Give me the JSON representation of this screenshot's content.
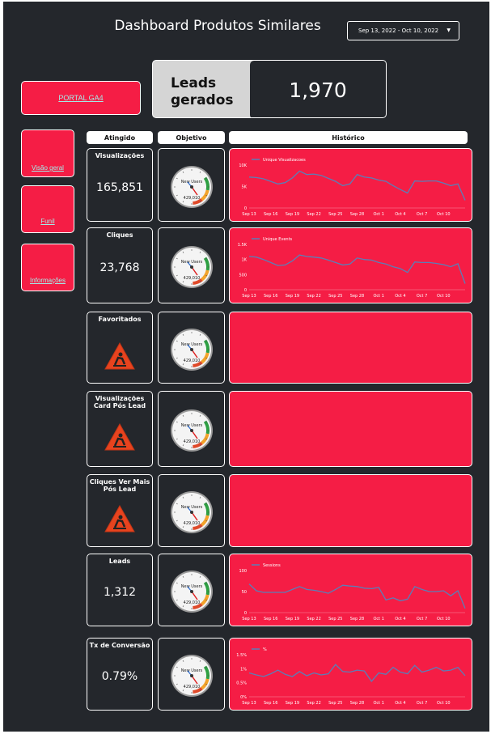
{
  "header": {
    "title": "Dashboard Produtos Similares",
    "date_range": "Sep 13, 2022 - Oct 10, 2022"
  },
  "portal": {
    "label": "PORTAL GA4"
  },
  "kpi": {
    "label_line1": "Leads",
    "label_line2": "gerados",
    "value": "1,970"
  },
  "nav": [
    {
      "label": "Visão geral"
    },
    {
      "label": "Funil"
    },
    {
      "label": "Informações"
    }
  ],
  "columns": {
    "atingido": "Atingido",
    "objetivo": "Objetivo",
    "historico": "Histórico"
  },
  "gauge": {
    "label": "New Users",
    "value": "429,010"
  },
  "colors": {
    "accent": "#f51d45",
    "background": "#24272c",
    "line": "#5a7fb8",
    "link": "#a4ece9"
  },
  "x_ticks": [
    "Sep 13",
    "Sep 16",
    "Sep 19",
    "Sep 22",
    "Sep 25",
    "Sep 28",
    "Oct 1",
    "Oct 4",
    "Oct 7",
    "Oct 10"
  ],
  "metrics": [
    {
      "label": "Visualizações",
      "value": "165,851",
      "icon": "under-construction-icon"
    },
    {
      "label": "Cliques",
      "value": "23,768",
      "icon": "under-construction-icon"
    },
    {
      "label": "Favoritados",
      "value": "",
      "icon": "under-construction-icon"
    },
    {
      "label": "Visualizações Card Pós Lead",
      "value": "",
      "icon": "under-construction-icon"
    },
    {
      "label": "Cliques Ver Mais Pós Lead",
      "value": "",
      "icon": "under-construction-icon"
    },
    {
      "label": "Leads",
      "value": "1,312",
      "icon": "under-construction-icon"
    },
    {
      "label": "Tx de Conversão",
      "value": "0.79%",
      "icon": "under-construction-icon"
    }
  ],
  "chart_data": [
    {
      "type": "line",
      "series": [
        {
          "name": "Unique Visualizacoes",
          "values": [
            7200,
            7100,
            6800,
            6200,
            5600,
            5900,
            7000,
            8600,
            7800,
            7900,
            7600,
            6900,
            6200,
            5200,
            5600,
            7800,
            7200,
            7000,
            6500,
            6200,
            5200,
            4300,
            3500,
            6300,
            6200,
            6300,
            6300,
            5800,
            5200,
            5600,
            1800
          ]
        }
      ],
      "ylim": [
        0,
        10000
      ],
      "yticks": [
        "0",
        "5K",
        "10K"
      ],
      "ytick_values": [
        0,
        5000,
        10000
      ]
    },
    {
      "type": "line",
      "series": [
        {
          "name": "Unique Events",
          "values": [
            1100,
            1080,
            1000,
            900,
            800,
            820,
            950,
            1150,
            1100,
            1080,
            1050,
            980,
            900,
            820,
            850,
            1050,
            1000,
            980,
            900,
            850,
            760,
            700,
            570,
            920,
            900,
            900,
            870,
            830,
            760,
            860,
            200
          ]
        }
      ],
      "ylim": [
        0,
        1500
      ],
      "yticks": [
        "0",
        "500",
        "1K",
        "1.5K"
      ],
      "ytick_values": [
        0,
        500,
        1000,
        1500
      ]
    },
    null,
    null,
    null,
    {
      "type": "line",
      "series": [
        {
          "name": "Sessions",
          "values": [
            68,
            52,
            48,
            48,
            48,
            48,
            55,
            62,
            55,
            53,
            50,
            46,
            55,
            65,
            63,
            62,
            58,
            57,
            60,
            30,
            35,
            28,
            32,
            62,
            55,
            50,
            50,
            52,
            40,
            52,
            10
          ]
        }
      ],
      "ylim": [
        0,
        100
      ],
      "yticks": [
        "0",
        "50",
        "100"
      ],
      "ytick_values": [
        0,
        50,
        100
      ]
    },
    {
      "type": "line",
      "series": [
        {
          "name": "%",
          "values": [
            0.85,
            0.78,
            0.72,
            0.82,
            0.95,
            0.8,
            0.72,
            0.9,
            0.75,
            0.85,
            0.78,
            0.82,
            1.15,
            0.9,
            0.88,
            0.95,
            0.92,
            0.55,
            0.85,
            0.8,
            1.05,
            0.88,
            0.82,
            1.12,
            0.88,
            0.95,
            1.05,
            0.92,
            0.95,
            1.05,
            0.75
          ]
        }
      ],
      "ylim": [
        0,
        1.5
      ],
      "yticks": [
        "0%",
        "0.5%",
        "1%",
        "1.5%"
      ],
      "ytick_values": [
        0,
        0.5,
        1,
        1.5
      ]
    }
  ]
}
